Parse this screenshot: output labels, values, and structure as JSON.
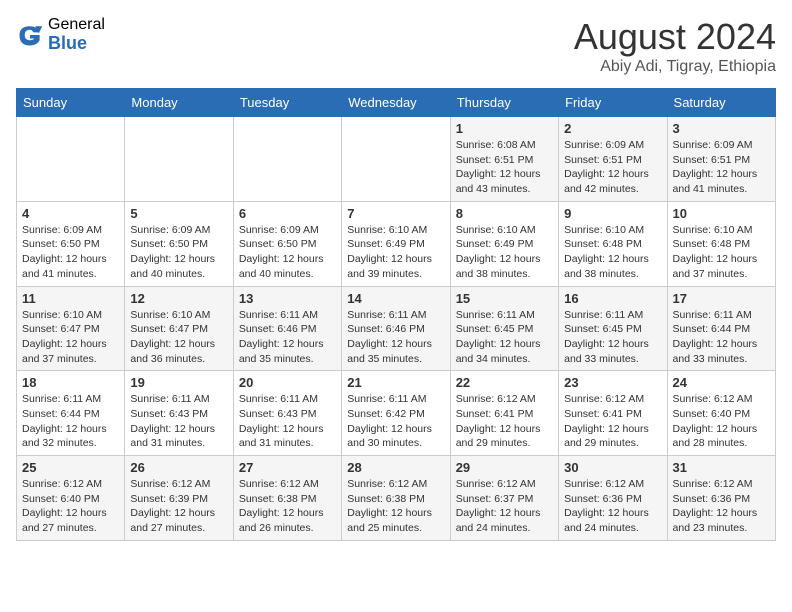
{
  "header": {
    "logo_general": "General",
    "logo_blue": "Blue",
    "month_title": "August 2024",
    "location": "Abiy Adi, Tigray, Ethiopia"
  },
  "weekdays": [
    "Sunday",
    "Monday",
    "Tuesday",
    "Wednesday",
    "Thursday",
    "Friday",
    "Saturday"
  ],
  "weeks": [
    [
      {
        "day": "",
        "info": ""
      },
      {
        "day": "",
        "info": ""
      },
      {
        "day": "",
        "info": ""
      },
      {
        "day": "",
        "info": ""
      },
      {
        "day": "1",
        "info": "Sunrise: 6:08 AM\nSunset: 6:51 PM\nDaylight: 12 hours\nand 43 minutes."
      },
      {
        "day": "2",
        "info": "Sunrise: 6:09 AM\nSunset: 6:51 PM\nDaylight: 12 hours\nand 42 minutes."
      },
      {
        "day": "3",
        "info": "Sunrise: 6:09 AM\nSunset: 6:51 PM\nDaylight: 12 hours\nand 41 minutes."
      }
    ],
    [
      {
        "day": "4",
        "info": "Sunrise: 6:09 AM\nSunset: 6:50 PM\nDaylight: 12 hours\nand 41 minutes."
      },
      {
        "day": "5",
        "info": "Sunrise: 6:09 AM\nSunset: 6:50 PM\nDaylight: 12 hours\nand 40 minutes."
      },
      {
        "day": "6",
        "info": "Sunrise: 6:09 AM\nSunset: 6:50 PM\nDaylight: 12 hours\nand 40 minutes."
      },
      {
        "day": "7",
        "info": "Sunrise: 6:10 AM\nSunset: 6:49 PM\nDaylight: 12 hours\nand 39 minutes."
      },
      {
        "day": "8",
        "info": "Sunrise: 6:10 AM\nSunset: 6:49 PM\nDaylight: 12 hours\nand 38 minutes."
      },
      {
        "day": "9",
        "info": "Sunrise: 6:10 AM\nSunset: 6:48 PM\nDaylight: 12 hours\nand 38 minutes."
      },
      {
        "day": "10",
        "info": "Sunrise: 6:10 AM\nSunset: 6:48 PM\nDaylight: 12 hours\nand 37 minutes."
      }
    ],
    [
      {
        "day": "11",
        "info": "Sunrise: 6:10 AM\nSunset: 6:47 PM\nDaylight: 12 hours\nand 37 minutes."
      },
      {
        "day": "12",
        "info": "Sunrise: 6:10 AM\nSunset: 6:47 PM\nDaylight: 12 hours\nand 36 minutes."
      },
      {
        "day": "13",
        "info": "Sunrise: 6:11 AM\nSunset: 6:46 PM\nDaylight: 12 hours\nand 35 minutes."
      },
      {
        "day": "14",
        "info": "Sunrise: 6:11 AM\nSunset: 6:46 PM\nDaylight: 12 hours\nand 35 minutes."
      },
      {
        "day": "15",
        "info": "Sunrise: 6:11 AM\nSunset: 6:45 PM\nDaylight: 12 hours\nand 34 minutes."
      },
      {
        "day": "16",
        "info": "Sunrise: 6:11 AM\nSunset: 6:45 PM\nDaylight: 12 hours\nand 33 minutes."
      },
      {
        "day": "17",
        "info": "Sunrise: 6:11 AM\nSunset: 6:44 PM\nDaylight: 12 hours\nand 33 minutes."
      }
    ],
    [
      {
        "day": "18",
        "info": "Sunrise: 6:11 AM\nSunset: 6:44 PM\nDaylight: 12 hours\nand 32 minutes."
      },
      {
        "day": "19",
        "info": "Sunrise: 6:11 AM\nSunset: 6:43 PM\nDaylight: 12 hours\nand 31 minutes."
      },
      {
        "day": "20",
        "info": "Sunrise: 6:11 AM\nSunset: 6:43 PM\nDaylight: 12 hours\nand 31 minutes."
      },
      {
        "day": "21",
        "info": "Sunrise: 6:11 AM\nSunset: 6:42 PM\nDaylight: 12 hours\nand 30 minutes."
      },
      {
        "day": "22",
        "info": "Sunrise: 6:12 AM\nSunset: 6:41 PM\nDaylight: 12 hours\nand 29 minutes."
      },
      {
        "day": "23",
        "info": "Sunrise: 6:12 AM\nSunset: 6:41 PM\nDaylight: 12 hours\nand 29 minutes."
      },
      {
        "day": "24",
        "info": "Sunrise: 6:12 AM\nSunset: 6:40 PM\nDaylight: 12 hours\nand 28 minutes."
      }
    ],
    [
      {
        "day": "25",
        "info": "Sunrise: 6:12 AM\nSunset: 6:40 PM\nDaylight: 12 hours\nand 27 minutes."
      },
      {
        "day": "26",
        "info": "Sunrise: 6:12 AM\nSunset: 6:39 PM\nDaylight: 12 hours\nand 27 minutes."
      },
      {
        "day": "27",
        "info": "Sunrise: 6:12 AM\nSunset: 6:38 PM\nDaylight: 12 hours\nand 26 minutes."
      },
      {
        "day": "28",
        "info": "Sunrise: 6:12 AM\nSunset: 6:38 PM\nDaylight: 12 hours\nand 25 minutes."
      },
      {
        "day": "29",
        "info": "Sunrise: 6:12 AM\nSunset: 6:37 PM\nDaylight: 12 hours\nand 24 minutes."
      },
      {
        "day": "30",
        "info": "Sunrise: 6:12 AM\nSunset: 6:36 PM\nDaylight: 12 hours\nand 24 minutes."
      },
      {
        "day": "31",
        "info": "Sunrise: 6:12 AM\nSunset: 6:36 PM\nDaylight: 12 hours\nand 23 minutes."
      }
    ]
  ]
}
